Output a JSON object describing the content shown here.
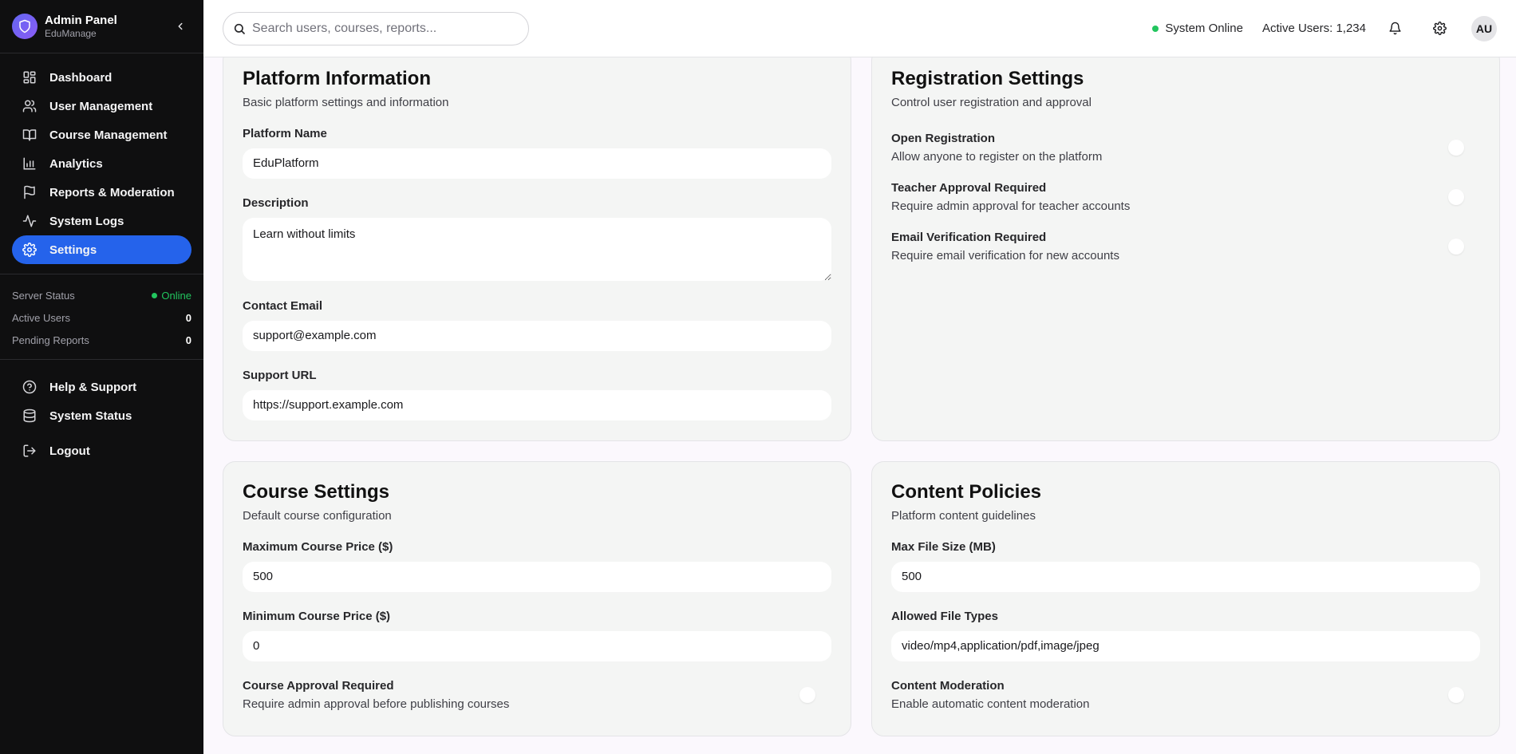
{
  "brand": {
    "title": "Admin Panel",
    "subtitle": "EduManage"
  },
  "nav": [
    {
      "label": "Dashboard",
      "icon": "dashboard-icon"
    },
    {
      "label": "User Management",
      "icon": "users-icon"
    },
    {
      "label": "Course Management",
      "icon": "book-icon"
    },
    {
      "label": "Analytics",
      "icon": "bar-chart-icon"
    },
    {
      "label": "Reports & Moderation",
      "icon": "flag-icon"
    },
    {
      "label": "System Logs",
      "icon": "activity-icon"
    },
    {
      "label": "Settings",
      "icon": "gear-icon",
      "active": true
    }
  ],
  "stats": {
    "server_status_label": "Server Status",
    "server_status_value": "Online",
    "active_users_label": "Active Users",
    "active_users_value": "0",
    "pending_reports_label": "Pending Reports",
    "pending_reports_value": "0"
  },
  "nav_bottom": [
    {
      "label": "Help & Support",
      "icon": "help-circle-icon"
    },
    {
      "label": "System Status",
      "icon": "database-icon"
    },
    {
      "label": "Logout",
      "icon": "logout-icon"
    }
  ],
  "topbar": {
    "search_placeholder": "Search users, courses, reports...",
    "system_status": "System Online",
    "active_users": "Active Users: 1,234",
    "avatar_initials": "AU"
  },
  "platform_info": {
    "title": "Platform Information",
    "subtitle": "Basic platform settings and information",
    "name_label": "Platform Name",
    "name_value": "EduPlatform",
    "description_label": "Description",
    "description_value": "Learn without limits",
    "email_label": "Contact Email",
    "email_value": "support@example.com",
    "url_label": "Support URL",
    "url_value": "https://support.example.com"
  },
  "registration": {
    "title": "Registration Settings",
    "subtitle": "Control user registration and approval",
    "items": [
      {
        "label": "Open Registration",
        "desc": "Allow anyone to register on the platform",
        "enabled": false
      },
      {
        "label": "Teacher Approval Required",
        "desc": "Require admin approval for teacher accounts",
        "enabled": false
      },
      {
        "label": "Email Verification Required",
        "desc": "Require email verification for new accounts",
        "enabled": false
      }
    ]
  },
  "course_settings": {
    "title": "Course Settings",
    "subtitle": "Default course configuration",
    "max_price_label": "Maximum Course Price ($)",
    "max_price_value": "500",
    "min_price_label": "Minimum Course Price ($)",
    "min_price_value": "0",
    "approval_label": "Course Approval Required",
    "approval_desc": "Require admin approval before publishing courses",
    "approval_enabled": false
  },
  "content_policies": {
    "title": "Content Policies",
    "subtitle": "Platform content guidelines",
    "max_file_label": "Max File Size (MB)",
    "max_file_value": "500",
    "file_types_label": "Allowed File Types",
    "file_types_value": "video/mp4,application/pdf,image/jpeg",
    "moderation_label": "Content Moderation",
    "moderation_desc": "Enable automatic content moderation",
    "moderation_enabled": false
  },
  "colors": {
    "sidebar_bg": "#0f0f10",
    "accent": "#2563eb",
    "online": "#22c55e",
    "card_bg": "#f4f5f4"
  }
}
